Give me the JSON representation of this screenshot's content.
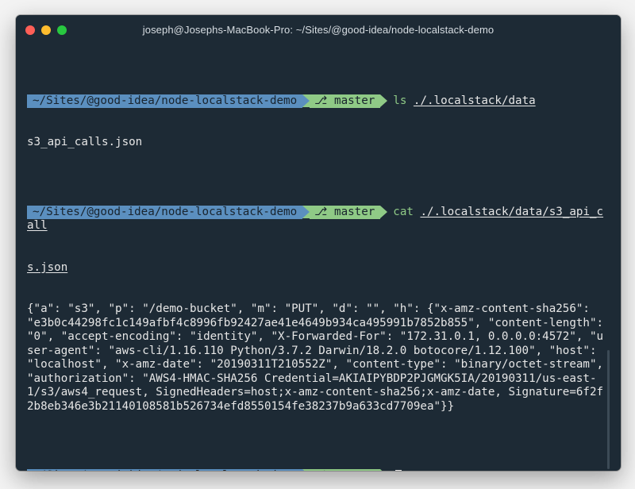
{
  "window": {
    "title": "joseph@Josephs-MacBook-Pro: ~/Sites/@good-idea/node-localstack-demo"
  },
  "prompt": {
    "path": "~/Sites/@good-idea/node-localstack-demo",
    "branch_symbol": "⎇",
    "branch": "master"
  },
  "commands": [
    {
      "cmd": "ls",
      "arg": "./.localstack/data",
      "output": "s3_api_calls.json"
    },
    {
      "cmd": "cat",
      "arg_line1": "./.localstack/data/s3_api_call",
      "arg_line2": "s.json",
      "output": "{\"a\": \"s3\", \"p\": \"/demo-bucket\", \"m\": \"PUT\", \"d\": \"\", \"h\": {\"x-amz-content-sha256\": \"e3b0c44298fc1c149afbf4c8996fb92427ae41e4649b934ca495991b7852b855\", \"content-length\": \"0\", \"accept-encoding\": \"identity\", \"X-Forwarded-For\": \"172.31.0.1, 0.0.0.0:4572\", \"user-agent\": \"aws-cli/1.16.110 Python/3.7.2 Darwin/18.2.0 botocore/1.12.100\", \"host\": \"localhost\", \"x-amz-date\": \"20190311T210552Z\", \"content-type\": \"binary/octet-stream\", \"authorization\": \"AWS4-HMAC-SHA256 Credential=AKIAIPYBDP2PJGMGK5IA/20190311/us-east-1/s3/aws4_request, SignedHeaders=host;x-amz-content-sha256;x-amz-date, Signature=6f2f2b8eb346e3b21140108581b526734efd8550154fe38237b9a633cd7709ea\"}}"
    }
  ],
  "icons": {
    "close": "close-icon",
    "minimize": "minimize-icon",
    "zoom": "zoom-icon",
    "branch": "git-branch-icon"
  },
  "colors": {
    "background": "#1d2a35",
    "path_segment": "#5b8fbf",
    "branch_segment": "#8fca86",
    "command": "#8fca86",
    "text": "#e6e6e6"
  }
}
